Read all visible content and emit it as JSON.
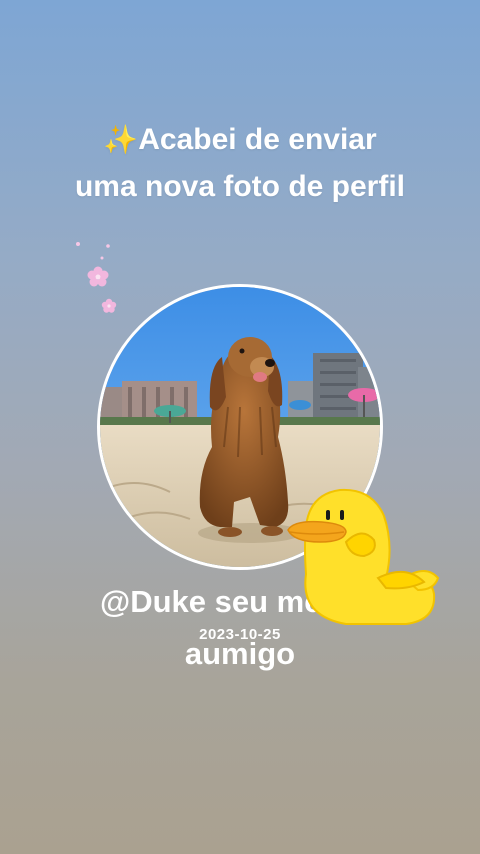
{
  "headline": {
    "sparkle_icon": "sparkles-icon",
    "line1": "Acabei de enviar",
    "line2": "uma nova foto de perfil"
  },
  "profile_photo": {
    "subject": "golden retriever on beach",
    "border_color": "#ffffff"
  },
  "caption": {
    "line1": "@Duke seu melhor",
    "line2": "aumigo"
  },
  "date": "2023-10-25",
  "stickers": {
    "duck": "yellow-duck-sticker",
    "flowers": "pink-flower-sparkles"
  },
  "colors": {
    "bg_top": "#7ea6d4",
    "bg_bottom": "#aaa190",
    "text": "#ffffff",
    "duck_yellow": "#ffe02a",
    "duck_beak": "#f4a51c"
  }
}
